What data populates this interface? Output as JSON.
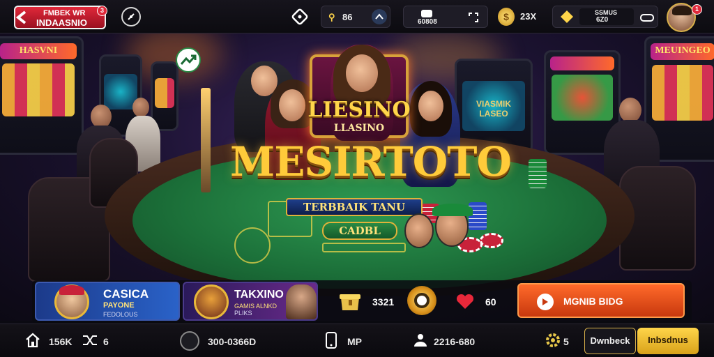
{
  "topbar": {
    "back_label_1": "FMBEK WR",
    "back_label_2": "INDAASNIO",
    "back_badge": "3",
    "score_value": "86",
    "center_label": "60808",
    "coins_value": "23X",
    "wallet_label": "SSMUS",
    "wallet_value": "6Z0",
    "avatar_badge": "1"
  },
  "scene": {
    "frame_title": "LIESINO",
    "frame_subtitle": "LLASINO",
    "main_title": "MESIRTOTO",
    "banner_text": "TERBBAIK TANU",
    "plaque_text": "CADBL",
    "slot_left_label": "HASVNI",
    "slot_mid_label": "VIASMIK LASEO",
    "slot_right_label": "MEUINGEO"
  },
  "lower_panel": {
    "card_1": {
      "title": "CASICA",
      "subtitle": "PAYONE",
      "caption": "FEDOLOUS"
    },
    "card_2": {
      "title": "TAKXINO",
      "subtitle": "GAMIS ALNKD",
      "caption": "PLIKS"
    },
    "stat_1": "3321",
    "stat_2": "60",
    "cta_label": "MGNIB BIDG"
  },
  "bottombar": {
    "home_value": "156K",
    "shuffle_value": "6",
    "coin_value": "300-0366D",
    "device_value": "MP",
    "users_value": "2216-680",
    "gear_value": "5",
    "btn_secondary": "Dwnbeck",
    "btn_primary": "Inbsdnus"
  },
  "colors": {
    "accent_red": "#e0283a",
    "accent_gold": "#ffcb3a",
    "cta_orange": "#ff6a2a",
    "felt_green": "#1b6e38"
  }
}
